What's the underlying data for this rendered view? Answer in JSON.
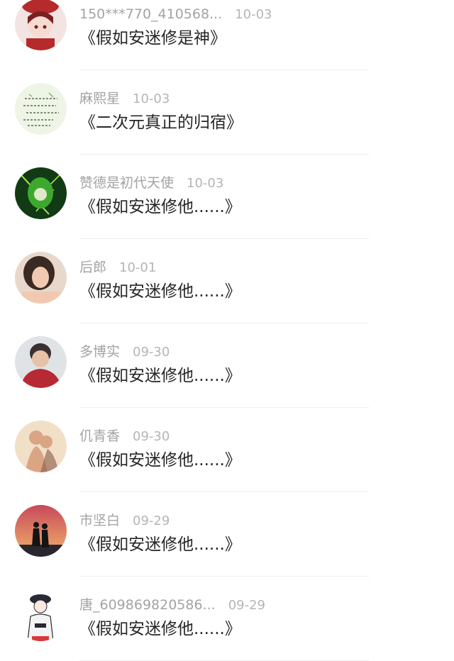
{
  "comments": [
    {
      "user": "150***770_410568...",
      "date": "10-03",
      "title": "《假如安迷修是神》",
      "avatar": "anime-girl-red-hat-avatar",
      "colors": [
        "#f3e3e3",
        "#b52a2a",
        "#7a2020"
      ]
    },
    {
      "user": "麻熙星",
      "date": "10-03",
      "title": "《二次元真正的归宿》",
      "avatar": "handwritten-note-avatar",
      "colors": [
        "#eef5e6",
        "#9ab58a",
        "#5a6e50"
      ]
    },
    {
      "user": "赞德是初代天使",
      "date": "10-03",
      "title": "《假如安迷修他......》",
      "avatar": "green-lightning-character-avatar",
      "colors": [
        "#123a14",
        "#3ea82e",
        "#a8e84b"
      ]
    },
    {
      "user": "后郎",
      "date": "10-01",
      "title": "《假如安迷修他......》",
      "avatar": "girl-portrait-avatar",
      "colors": [
        "#e8d8cc",
        "#3b2a24",
        "#f1c9b1"
      ]
    },
    {
      "user": "多博实",
      "date": "09-30",
      "title": "《假如安迷修他......》",
      "avatar": "person-red-sweater-avatar",
      "colors": [
        "#dfe3e6",
        "#b72a34",
        "#3a3030"
      ]
    },
    {
      "user": "仉青香",
      "date": "09-30",
      "title": "《假如安迷修他......》",
      "avatar": "couple-illustration-avatar",
      "colors": [
        "#f1dfc7",
        "#d9a585",
        "#8a5a44"
      ]
    },
    {
      "user": "市坚白",
      "date": "09-29",
      "title": "《假如安迷修他......》",
      "avatar": "sunset-couple-silhouette-avatar",
      "colors": [
        "#f4b36a",
        "#c64a5a",
        "#141414"
      ]
    },
    {
      "user": "唐_609869820586...",
      "date": "09-29",
      "title": "《假如安迷修他......》",
      "avatar": "cap-girl-sketch-avatar",
      "colors": [
        "#ffffff",
        "#2a2a36",
        "#d93a3a"
      ]
    }
  ]
}
